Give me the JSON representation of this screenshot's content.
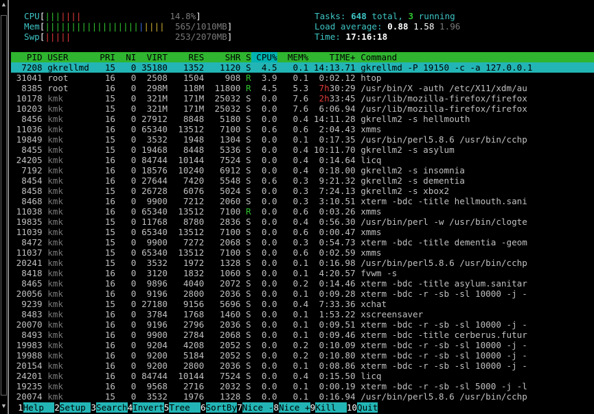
{
  "meters": {
    "cpu": {
      "label": "CPU",
      "value": "14.8%"
    },
    "mem": {
      "label": "Mem",
      "value": "565/1010MB"
    },
    "swp": {
      "label": "Swp",
      "value": "253/2070MB"
    }
  },
  "summary": {
    "tasks_label": "Tasks: ",
    "tasks_total": "648",
    "tasks_mid": " total, ",
    "tasks_running": "3",
    "tasks_end": " running",
    "load_label": "Load average: ",
    "load1": "0.88",
    "load5": "1.58",
    "load15": "1.96",
    "time_label": "Time: ",
    "time": "17:16:18"
  },
  "columns": [
    "PID",
    "USER",
    "PRI",
    "NI",
    "VIRT",
    "RES",
    "SHR",
    "S",
    "CPU%",
    "MEM%",
    "TIME+",
    "Command"
  ],
  "processes": [
    {
      "pid": "7208",
      "user": "gkrellmd",
      "pri": "15",
      "ni": "0",
      "virt": "35180",
      "res": "1352",
      "shr": "1120",
      "s": "S",
      "cpu": "4.5",
      "mem": "0.1",
      "time": "14:13.71",
      "cmd": "gkrellmd -P 19150 -c -a 127.0.0.1",
      "selected": true
    },
    {
      "pid": "31041",
      "user": "root",
      "pri": "16",
      "ni": "0",
      "virt": "2508",
      "res": "1504",
      "shr": "908",
      "s": "R",
      "cpu": "3.9",
      "mem": "0.1",
      "time": "0:02.12",
      "cmd": "htop"
    },
    {
      "pid": "8385",
      "user": "root",
      "pri": "16",
      "ni": "0",
      "virt": "298M",
      "res": "118M",
      "shr": "11800",
      "s": "R",
      "cpu": "4.5",
      "mem": "5.3",
      "time_h": "7h",
      "time": "30:29",
      "cmd": "/usr/bin/X -auth /etc/X11/xdm/au"
    },
    {
      "pid": "10178",
      "user": "kmk",
      "pri": "15",
      "ni": "0",
      "virt": "321M",
      "res": "171M",
      "shr": "25032",
      "s": "S",
      "cpu": "0.0",
      "mem": "7.6",
      "time_h": "2h",
      "time": "33:45",
      "cmd": "/usr/lib/mozilla-firefox/firefox"
    },
    {
      "pid": "10203",
      "user": "kmk",
      "pri": "15",
      "ni": "0",
      "virt": "321M",
      "res": "171M",
      "shr": "25032",
      "s": "S",
      "cpu": "0.0",
      "mem": "7.6",
      "time": "6:06.94",
      "cmd": "/usr/lib/mozilla-firefox/firefox"
    },
    {
      "pid": "8456",
      "user": "kmk",
      "pri": "16",
      "ni": "0",
      "virt": "27912",
      "res": "8848",
      "shr": "5180",
      "s": "S",
      "cpu": "0.0",
      "mem": "0.4",
      "time": "14:11.28",
      "cmd": "gkrellm2 -s hellmouth"
    },
    {
      "pid": "11036",
      "user": "kmk",
      "pri": "16",
      "ni": "0",
      "virt": "65340",
      "res": "13512",
      "shr": "7100",
      "s": "S",
      "cpu": "0.6",
      "mem": "0.6",
      "time": "2:04.43",
      "cmd": "xmms"
    },
    {
      "pid": "19849",
      "user": "kmk",
      "pri": "15",
      "ni": "0",
      "virt": "3532",
      "res": "1948",
      "shr": "1304",
      "s": "S",
      "cpu": "0.0",
      "mem": "0.1",
      "time": "0:17.35",
      "cmd": "/usr/bin/perl5.8.6 /usr/bin/cchp"
    },
    {
      "pid": "8455",
      "user": "kmk",
      "pri": "15",
      "ni": "0",
      "virt": "19468",
      "res": "8448",
      "shr": "5336",
      "s": "S",
      "cpu": "0.0",
      "mem": "0.4",
      "time": "10:11.70",
      "cmd": "gkrellm2 -s asylum"
    },
    {
      "pid": "24205",
      "user": "kmk",
      "pri": "16",
      "ni": "0",
      "virt": "84744",
      "res": "10144",
      "shr": "7524",
      "s": "S",
      "cpu": "0.0",
      "mem": "0.4",
      "time": "0:14.64",
      "cmd": "licq"
    },
    {
      "pid": "7192",
      "user": "kmk",
      "pri": "16",
      "ni": "0",
      "virt": "18576",
      "res": "10240",
      "shr": "6912",
      "s": "S",
      "cpu": "0.0",
      "mem": "0.4",
      "time": "0:18.00",
      "cmd": "gkrellm2 -s insomnia"
    },
    {
      "pid": "8454",
      "user": "kmk",
      "pri": "16",
      "ni": "0",
      "virt": "27644",
      "res": "7420",
      "shr": "5548",
      "s": "S",
      "cpu": "0.6",
      "mem": "0.3",
      "time": "9:21.32",
      "cmd": "gkrellm2 -s dementia"
    },
    {
      "pid": "8458",
      "user": "kmk",
      "pri": "15",
      "ni": "0",
      "virt": "26728",
      "res": "6076",
      "shr": "5024",
      "s": "S",
      "cpu": "0.0",
      "mem": "0.3",
      "time": "7:24.13",
      "cmd": "gkrellm2 -s xbox2"
    },
    {
      "pid": "8468",
      "user": "kmk",
      "pri": "16",
      "ni": "0",
      "virt": "9900",
      "res": "7212",
      "shr": "2060",
      "s": "S",
      "cpu": "0.0",
      "mem": "0.3",
      "time": "3:10.51",
      "cmd": "xterm -bdc -title hellmouth.sani"
    },
    {
      "pid": "11038",
      "user": "kmk",
      "pri": "16",
      "ni": "0",
      "virt": "65340",
      "res": "13512",
      "shr": "7100",
      "s": "R",
      "cpu": "0.0",
      "mem": "0.6",
      "time": "0:03.26",
      "cmd": "xmms"
    },
    {
      "pid": "19835",
      "user": "kmk",
      "pri": "15",
      "ni": "0",
      "virt": "11768",
      "res": "8780",
      "shr": "2836",
      "s": "S",
      "cpu": "0.0",
      "mem": "0.4",
      "time": "0:56.30",
      "cmd": "/usr/bin/perl -w /usr/bin/clogte"
    },
    {
      "pid": "11039",
      "user": "kmk",
      "pri": "15",
      "ni": "0",
      "virt": "65340",
      "res": "13512",
      "shr": "7100",
      "s": "S",
      "cpu": "0.0",
      "mem": "0.6",
      "time": "0:00.47",
      "cmd": "xmms"
    },
    {
      "pid": "8472",
      "user": "kmk",
      "pri": "15",
      "ni": "0",
      "virt": "9900",
      "res": "7272",
      "shr": "2068",
      "s": "S",
      "cpu": "0.0",
      "mem": "0.3",
      "time": "0:54.73",
      "cmd": "xterm -bdc -title dementia -geom"
    },
    {
      "pid": "11037",
      "user": "kmk",
      "pri": "15",
      "ni": "0",
      "virt": "65340",
      "res": "13512",
      "shr": "7100",
      "s": "S",
      "cpu": "0.0",
      "mem": "0.6",
      "time": "0:02.59",
      "cmd": "xmms"
    },
    {
      "pid": "20241",
      "user": "kmk",
      "pri": "15",
      "ni": "0",
      "virt": "3532",
      "res": "1972",
      "shr": "1328",
      "s": "S",
      "cpu": "0.0",
      "mem": "0.1",
      "time": "0:16.98",
      "cmd": "/usr/bin/perl5.8.6 /usr/bin/cchp"
    },
    {
      "pid": "8418",
      "user": "kmk",
      "pri": "16",
      "ni": "0",
      "virt": "3120",
      "res": "1832",
      "shr": "1060",
      "s": "S",
      "cpu": "0.0",
      "mem": "0.1",
      "time": "4:20.57",
      "cmd": "fvwm -s"
    },
    {
      "pid": "8465",
      "user": "kmk",
      "pri": "16",
      "ni": "0",
      "virt": "9896",
      "res": "4040",
      "shr": "2072",
      "s": "S",
      "cpu": "0.0",
      "mem": "0.2",
      "time": "0:14.46",
      "cmd": "xterm -bdc -title asylum.sanitar"
    },
    {
      "pid": "20056",
      "user": "kmk",
      "pri": "16",
      "ni": "0",
      "virt": "9196",
      "res": "2800",
      "shr": "2036",
      "s": "S",
      "cpu": "0.0",
      "mem": "0.1",
      "time": "0:09.28",
      "cmd": "xterm -bdc -r -sb -sl 10000 -j -"
    },
    {
      "pid": "9239",
      "user": "kmk",
      "pri": "15",
      "ni": "0",
      "virt": "27180",
      "res": "9156",
      "shr": "5696",
      "s": "S",
      "cpu": "0.0",
      "mem": "0.4",
      "time": "7:33.36",
      "cmd": "xchat"
    },
    {
      "pid": "8483",
      "user": "kmk",
      "pri": "16",
      "ni": "0",
      "virt": "3784",
      "res": "1768",
      "shr": "1460",
      "s": "S",
      "cpu": "0.0",
      "mem": "0.1",
      "time": "1:53.22",
      "cmd": "xscreensaver"
    },
    {
      "pid": "20070",
      "user": "kmk",
      "pri": "16",
      "ni": "0",
      "virt": "9196",
      "res": "2796",
      "shr": "2036",
      "s": "S",
      "cpu": "0.0",
      "mem": "0.1",
      "time": "0:09.51",
      "cmd": "xterm -bdc -r -sb -sl 10000 -j -"
    },
    {
      "pid": "8493",
      "user": "kmk",
      "pri": "16",
      "ni": "0",
      "virt": "9900",
      "res": "2784",
      "shr": "2068",
      "s": "S",
      "cpu": "0.0",
      "mem": "0.1",
      "time": "0:09.46",
      "cmd": "xterm -bdc -title cerberus.futur"
    },
    {
      "pid": "19983",
      "user": "kmk",
      "pri": "16",
      "ni": "0",
      "virt": "9204",
      "res": "4208",
      "shr": "2052",
      "s": "S",
      "cpu": "0.0",
      "mem": "0.2",
      "time": "0:10.09",
      "cmd": "xterm -bdc -r -sb -sl 10000 -j -"
    },
    {
      "pid": "19988",
      "user": "kmk",
      "pri": "16",
      "ni": "0",
      "virt": "9200",
      "res": "5184",
      "shr": "2052",
      "s": "S",
      "cpu": "0.0",
      "mem": "0.2",
      "time": "0:10.80",
      "cmd": "xterm -bdc -r -sb -sl 10000 -j -"
    },
    {
      "pid": "20154",
      "user": "kmk",
      "pri": "16",
      "ni": "0",
      "virt": "9200",
      "res": "2800",
      "shr": "2036",
      "s": "S",
      "cpu": "0.0",
      "mem": "0.1",
      "time": "0:08.86",
      "cmd": "xterm -bdc -r -sb -sl 10000 -j -"
    },
    {
      "pid": "24201",
      "user": "kmk",
      "pri": "16",
      "ni": "0",
      "virt": "84744",
      "res": "10144",
      "shr": "7524",
      "s": "S",
      "cpu": "0.0",
      "mem": "0.4",
      "time": "0:15.50",
      "cmd": "licq"
    },
    {
      "pid": "19235",
      "user": "kmk",
      "pri": "16",
      "ni": "0",
      "virt": "9568",
      "res": "2716",
      "shr": "2032",
      "s": "S",
      "cpu": "0.0",
      "mem": "0.1",
      "time": "0:00.19",
      "cmd": "xterm -bdc -r -sb -sl 5000 -j -l"
    },
    {
      "pid": "20074",
      "user": "kmk",
      "pri": "15",
      "ni": "0",
      "virt": "3532",
      "res": "1976",
      "shr": "1328",
      "s": "S",
      "cpu": "0.0",
      "mem": "0.1",
      "time": "0:16.94",
      "cmd": "/usr/bin/perl5.8.6 /usr/bin/cchp"
    }
  ],
  "footer": [
    {
      "key": "1",
      "label": "Help  "
    },
    {
      "key": "2",
      "label": "Setup "
    },
    {
      "key": "3",
      "label": "Search"
    },
    {
      "key": "4",
      "label": "Invert"
    },
    {
      "key": "5",
      "label": "Tree  "
    },
    {
      "key": "6",
      "label": "SortBy"
    },
    {
      "key": "7",
      "label": "Nice -"
    },
    {
      "key": "8",
      "label": "Nice +"
    },
    {
      "key": "9",
      "label": "Kill  "
    },
    {
      "key": "10",
      "label": "Quit"
    }
  ],
  "colors": {
    "header_bg": "#2fb52f",
    "selection": "#23b5b5",
    "accent_cyan": "#3fc5c5",
    "time_red": "#e23a3a",
    "running_green": "#2fc52f"
  }
}
